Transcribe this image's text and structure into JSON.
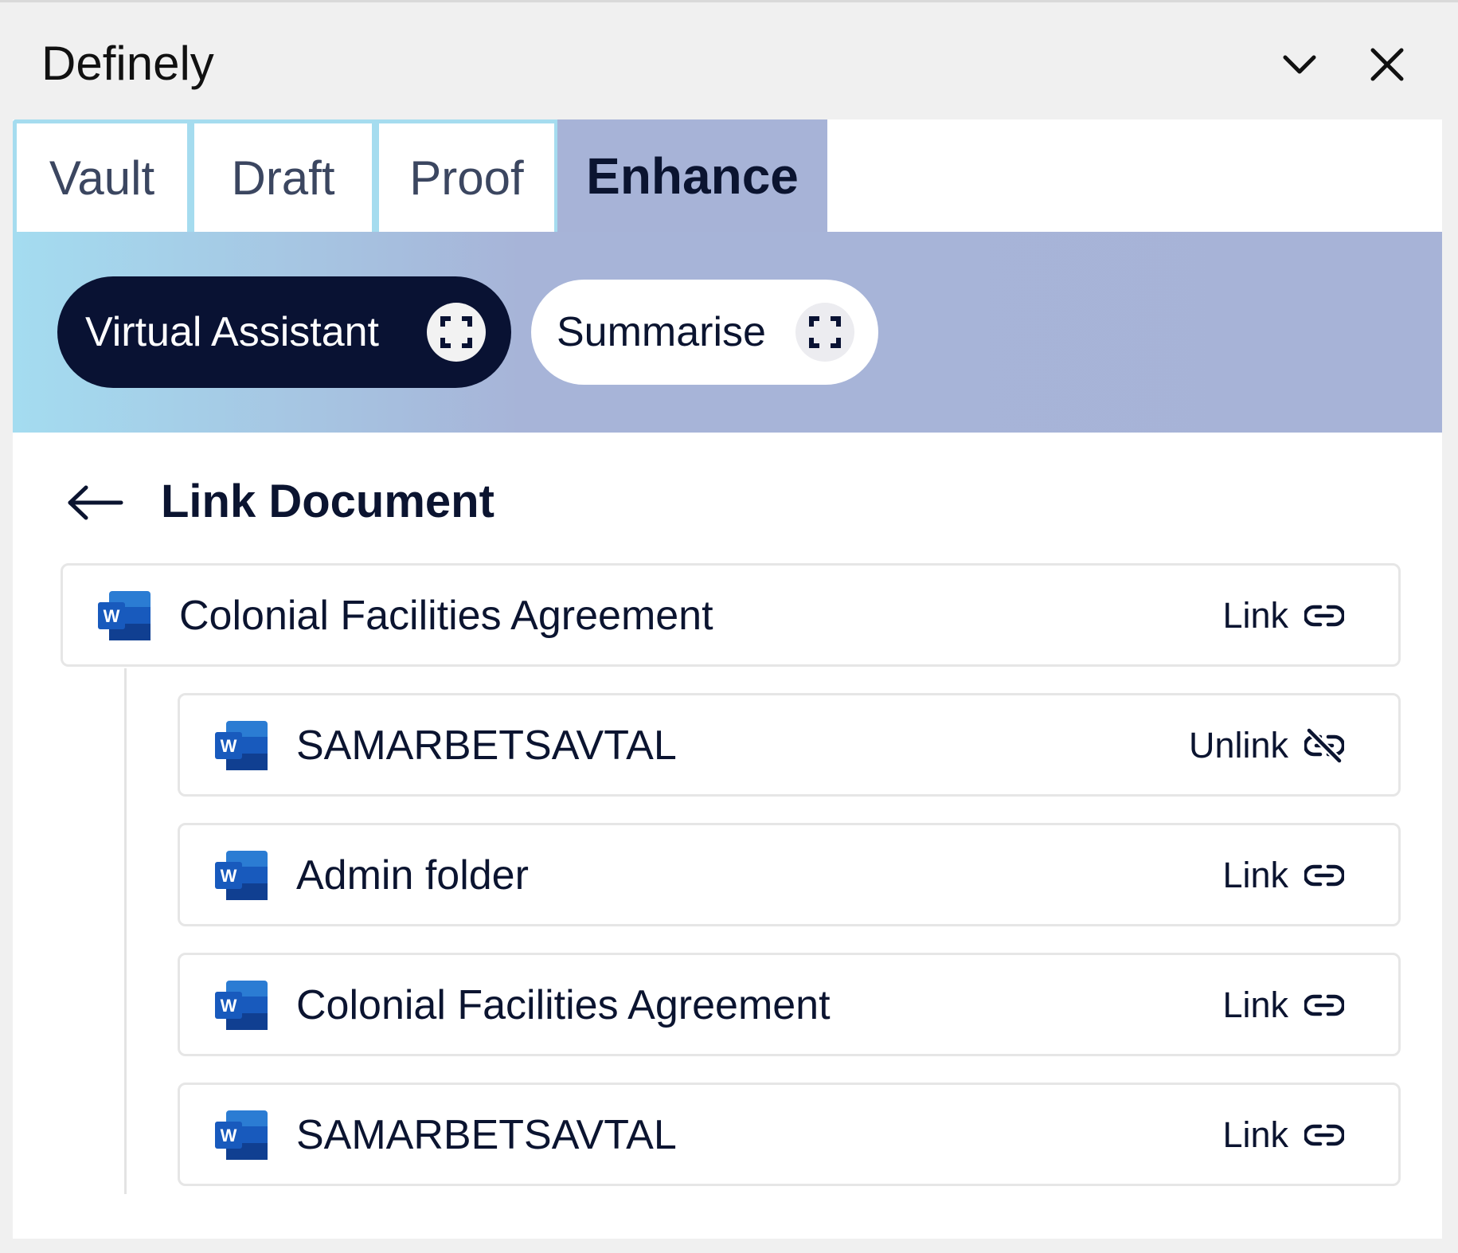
{
  "window": {
    "title": "Definely",
    "collapse_icon": "chevron-down-icon",
    "close_icon": "close-icon"
  },
  "tabs": [
    {
      "label": "Vault",
      "active": false
    },
    {
      "label": "Draft",
      "active": false
    },
    {
      "label": "Proof",
      "active": false
    },
    {
      "label": "Enhance",
      "active": true
    }
  ],
  "features": [
    {
      "label": "Virtual Assistant",
      "icon": "expand-icon",
      "selected": true
    },
    {
      "label": "Summarise",
      "icon": "expand-icon",
      "selected": false
    }
  ],
  "link_document": {
    "title": "Link Document",
    "back_icon": "arrow-left-icon",
    "root": {
      "name": "Colonial Facilities Agreement",
      "action": "Link",
      "icon": "link-icon"
    },
    "children": [
      {
        "name": "SAMARBETSAVTAL",
        "action": "Unlink",
        "icon": "unlink-icon"
      },
      {
        "name": "Admin folder",
        "action": "Link",
        "icon": "link-icon"
      },
      {
        "name": "Colonial Facilities Agreement",
        "action": "Link",
        "icon": "link-icon"
      },
      {
        "name": "SAMARBETSAVTAL",
        "action": "Link",
        "icon": "link-icon"
      }
    ],
    "file_icon": "word-document-icon"
  },
  "colors": {
    "accent_dark": "#091233",
    "tab_active": "#a7b3d7",
    "tab_border": "#a5dcef",
    "word_blue": "#185abd"
  }
}
